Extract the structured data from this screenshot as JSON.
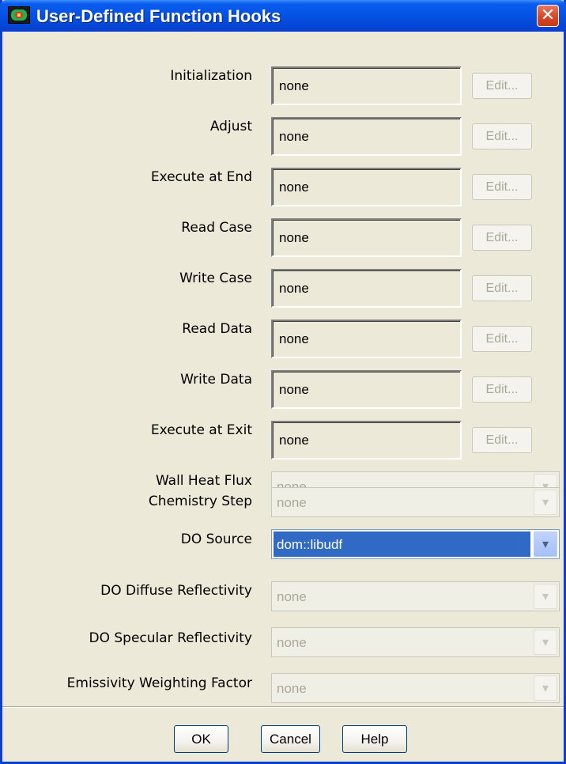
{
  "window": {
    "title": "User-Defined Function Hooks",
    "close_glyph": "✕"
  },
  "hooks": [
    {
      "label": "Initialization",
      "value": "none",
      "edit_label": "Edit..."
    },
    {
      "label": "Adjust",
      "value": "none",
      "edit_label": "Edit..."
    },
    {
      "label": "Execute at End",
      "value": "none",
      "edit_label": "Edit..."
    },
    {
      "label": "Read Case",
      "value": "none",
      "edit_label": "Edit..."
    },
    {
      "label": "Write Case",
      "value": "none",
      "edit_label": "Edit..."
    },
    {
      "label": "Read Data",
      "value": "none",
      "edit_label": "Edit..."
    },
    {
      "label": "Write Data",
      "value": "none",
      "edit_label": "Edit..."
    },
    {
      "label": "Execute at Exit",
      "value": "none",
      "edit_label": "Edit..."
    }
  ],
  "selectors": [
    {
      "label": "Wall Heat Flux",
      "value": "none",
      "enabled": false
    },
    {
      "label": "Chemistry Step",
      "value": "none",
      "enabled": false
    },
    {
      "label": "DO Source",
      "value": "dom::libudf",
      "enabled": true
    },
    {
      "label": "DO Diffuse Reflectivity",
      "value": "none",
      "enabled": false
    },
    {
      "label": "DO Specular Reflectivity",
      "value": "none",
      "enabled": false
    },
    {
      "label": "Emissivity Weighting Factor",
      "value": "none",
      "enabled": false
    }
  ],
  "buttons": {
    "ok": "OK",
    "cancel": "Cancel",
    "help": "Help"
  },
  "icons": {
    "app": "fluent-app-icon",
    "dropdown": "chevron-down-icon",
    "close": "close-icon"
  },
  "colors": {
    "titlebar": "#0553e4",
    "selection": "#316ac5",
    "dialog_bg": "#ece9d8"
  }
}
